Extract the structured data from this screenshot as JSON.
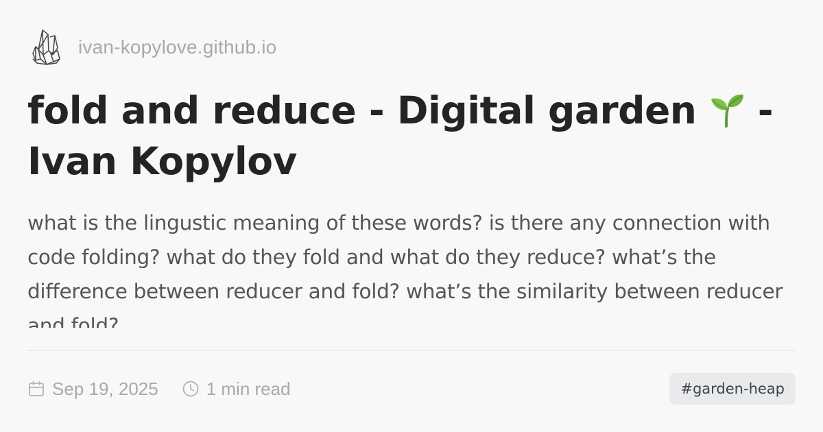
{
  "site": {
    "logo_icon": "crystal-cluster-icon",
    "name": "ivan-kopylove.github.io"
  },
  "article": {
    "title_part1": "fold and reduce - Digital garden",
    "title_emoji_icon": "seedling-icon",
    "title_part2": "- Ivan Kopylov",
    "description": "what is the lingustic meaning of these words? is there any connection with code folding? what do they fold and what do they reduce? what’s the difference between reducer and fold? what’s the similarity between reducer and fold?"
  },
  "meta": {
    "date_icon": "calendar-icon",
    "date": "Sep 19, 2025",
    "read_time_icon": "clock-icon",
    "read_time": "1 min read",
    "tag": "#garden-heap"
  },
  "colors": {
    "background": "#f8f8f9",
    "title": "#242424",
    "description": "#555558",
    "muted": "#a8a8ad",
    "tag_bg": "#e9eaec",
    "sprout_green": "#6fb43f"
  }
}
